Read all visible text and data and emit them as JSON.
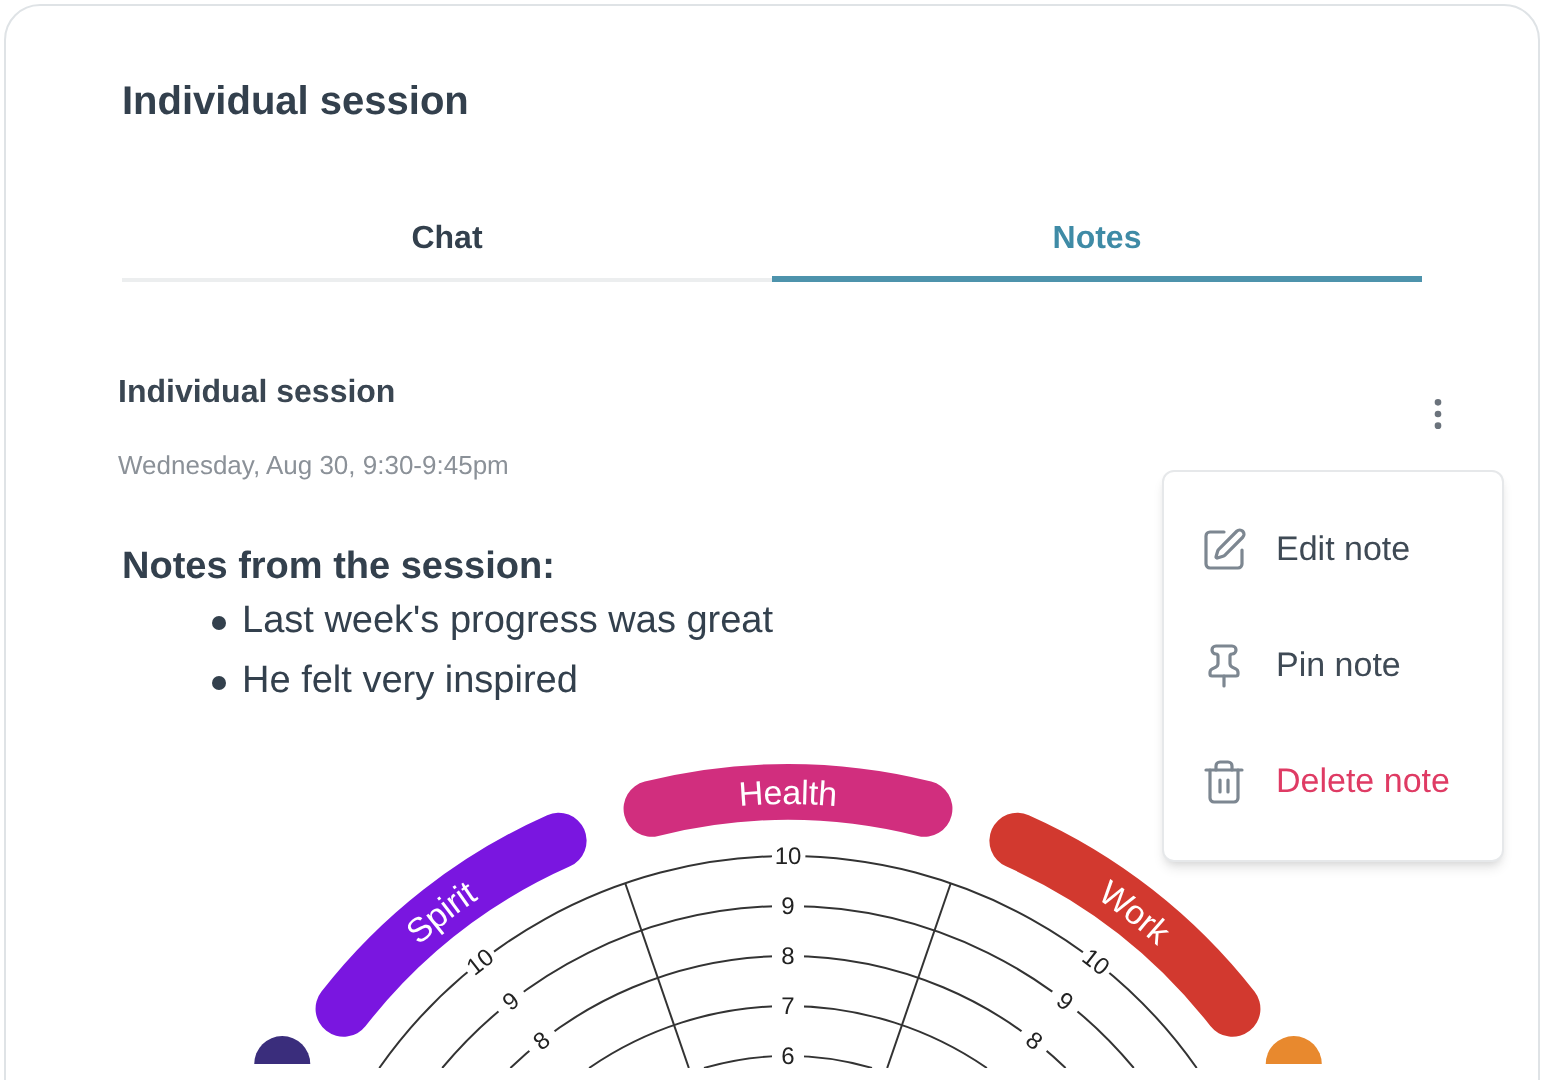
{
  "card": {
    "title": "Individual session"
  },
  "tabs": [
    {
      "label": "Chat",
      "selected": false
    },
    {
      "label": "Notes",
      "selected": true
    }
  ],
  "note": {
    "title": "Individual session",
    "date": "Wednesday, Aug 30, 9:30-9:45pm",
    "heading": "Notes from the session:",
    "bullets": [
      "Last week's progress was great",
      "He felt very inspired"
    ]
  },
  "menu": {
    "open": true,
    "items": [
      {
        "label": "Edit note",
        "kind": "edit"
      },
      {
        "label": "Pin note",
        "kind": "pin"
      },
      {
        "label": "Delete note",
        "kind": "delete"
      }
    ]
  },
  "wheel": {
    "segments": [
      {
        "label": "Spirit",
        "color": "#7a16e0",
        "ticks": [
          "10",
          "9",
          "8"
        ]
      },
      {
        "label": "Health",
        "color": "#d12e7e",
        "ticks": [
          "10",
          "9",
          "8",
          "7",
          "6"
        ]
      },
      {
        "label": "Work",
        "color": "#d2392f",
        "ticks": [
          "10",
          "9",
          "8"
        ]
      }
    ],
    "cut_off_segments": [
      {
        "color": "#3a2d7c"
      },
      {
        "color": "#e8892e"
      }
    ]
  }
}
